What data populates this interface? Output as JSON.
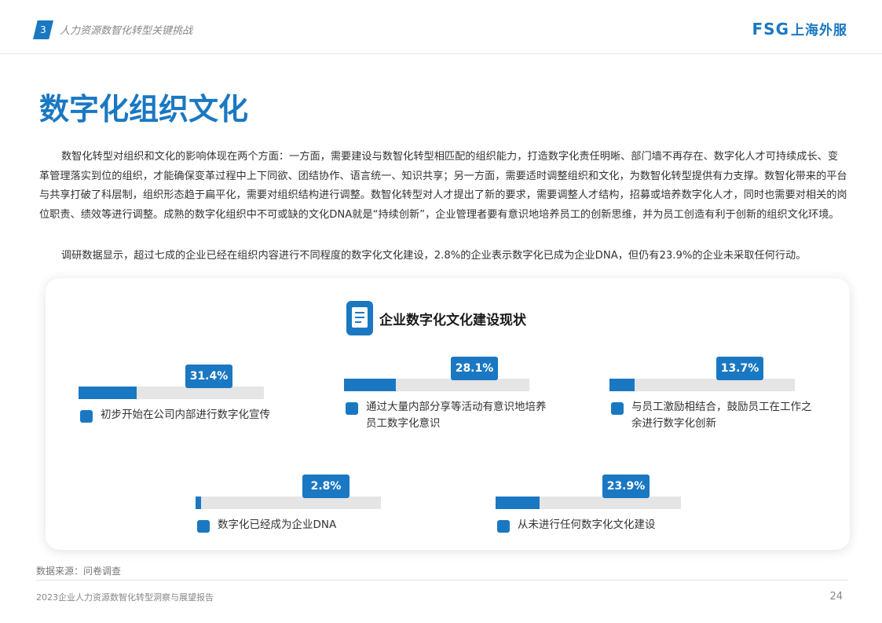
{
  "header": {
    "section_number": "3",
    "section_title": "人力资源数智化转型关键挑战",
    "logo_latin": "FSG",
    "logo_cn": "上海外服"
  },
  "page_title": "数字化组织文化",
  "paragraphs": [
    "数智化转型对组织和文化的影响体现在两个方面：一方面，需要建设与数智化转型相匹配的组织能力，打造数字化责任明晰、部门墙不再存在、数字化人才可持续成长、变革管理落实到位的组织，才能确保变革过程中上下同欲、团结协作、语言统一、知识共享；另一方面，需要适时调整组织和文化，为数智化转型提供有力支撑。数智化带来的平台与共享打破了科层制，组织形态趋于扁平化，需要对组织结构进行调整。数智化转型对人才提出了新的要求，需要调整人才结构，招募或培养数字化人才，同时也需要对相关的岗位职责、绩效等进行调整。成熟的数字化组织中不可或缺的文化DNA就是“持续创新”，企业管理者要有意识地培养员工的创新思维，并为员工创造有利于创新的组织文化环境。",
    "调研数据显示，超过七成的企业已经在组织内容进行不同程度的数字化文化建设，2.8%的企业表示数字化已成为企业DNA，但仍有23.9%的企业未采取任何行动。"
  ],
  "card": {
    "title": "企业数字化文化建设现状",
    "icon": "document-icon",
    "accent_color": "#1a78c2",
    "track_color": "#e5e5e5",
    "stats": [
      {
        "value": 31.4,
        "label_pct": "31.4%",
        "label": "初步开始在公司内部进行数字化宣传"
      },
      {
        "value": 28.1,
        "label_pct": "28.1%",
        "label": "通过大量内部分享等活动有意识地培养员工数字化意识"
      },
      {
        "value": 13.7,
        "label_pct": "13.7%",
        "label": "与员工激励相结合，鼓励员工在工作之余进行数字化创新"
      },
      {
        "value": 2.8,
        "label_pct": "2.8%",
        "label": "数字化已经成为企业DNA"
      },
      {
        "value": 23.9,
        "label_pct": "23.9%",
        "label": "从未进行任何数字化文化建设"
      }
    ]
  },
  "source": "数据来源：问卷调查",
  "footer": {
    "report_title": "2023企业人力资源数智化转型洞察与展望报告",
    "page_number": "24"
  }
}
